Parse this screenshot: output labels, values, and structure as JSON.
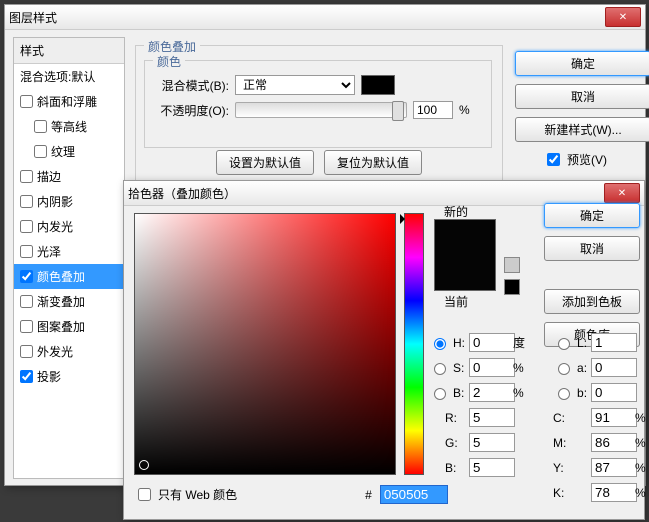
{
  "layerStyle": {
    "title": "图层样式",
    "stylesHeader": "样式",
    "blendOptions": "混合选项:默认",
    "items": [
      {
        "label": "斜面和浮雕",
        "checked": false
      },
      {
        "label": "等高线",
        "checked": false,
        "indent": true
      },
      {
        "label": "纹理",
        "checked": false,
        "indent": true
      },
      {
        "label": "描边",
        "checked": false
      },
      {
        "label": "内阴影",
        "checked": false
      },
      {
        "label": "内发光",
        "checked": false
      },
      {
        "label": "光泽",
        "checked": false
      },
      {
        "label": "颜色叠加",
        "checked": true,
        "selected": true
      },
      {
        "label": "渐变叠加",
        "checked": false
      },
      {
        "label": "图案叠加",
        "checked": false
      },
      {
        "label": "外发光",
        "checked": false
      },
      {
        "label": "投影",
        "checked": true
      }
    ],
    "overlaySection": "颜色叠加",
    "colorSection": "颜色",
    "blendModeLabel": "混合模式(B):",
    "blendModeValue": "正常",
    "opacityLabel": "不透明度(O):",
    "opacityValue": "100",
    "percent": "%",
    "setDefault": "设置为默认值",
    "resetDefault": "复位为默认值",
    "ok": "确定",
    "cancel": "取消",
    "newStyle": "新建样式(W)...",
    "preview": "预览(V)"
  },
  "picker": {
    "title": "拾色器（叠加颜色）",
    "new": "新的",
    "current": "当前",
    "ok": "确定",
    "cancel": "取消",
    "addSwatch": "添加到色板",
    "colorLib": "颜色库",
    "H": "H:",
    "S": "S:",
    "Bv": "B:",
    "L": "L:",
    "a": "a:",
    "b": "b:",
    "R": "R:",
    "G": "G:",
    "Bc": "B:",
    "C": "C:",
    "M": "M:",
    "Y": "Y:",
    "K": "K:",
    "deg": "度",
    "pct": "%",
    "vals": {
      "H": "0",
      "S": "0",
      "B": "2",
      "L": "1",
      "a": "0",
      "b": "0",
      "R": "5",
      "G": "5",
      "Bc": "5",
      "C": "91",
      "M": "86",
      "Y": "87",
      "K": "78"
    },
    "hashLabel": "#",
    "hex": "050505",
    "webOnly": "只有 Web 颜色"
  }
}
